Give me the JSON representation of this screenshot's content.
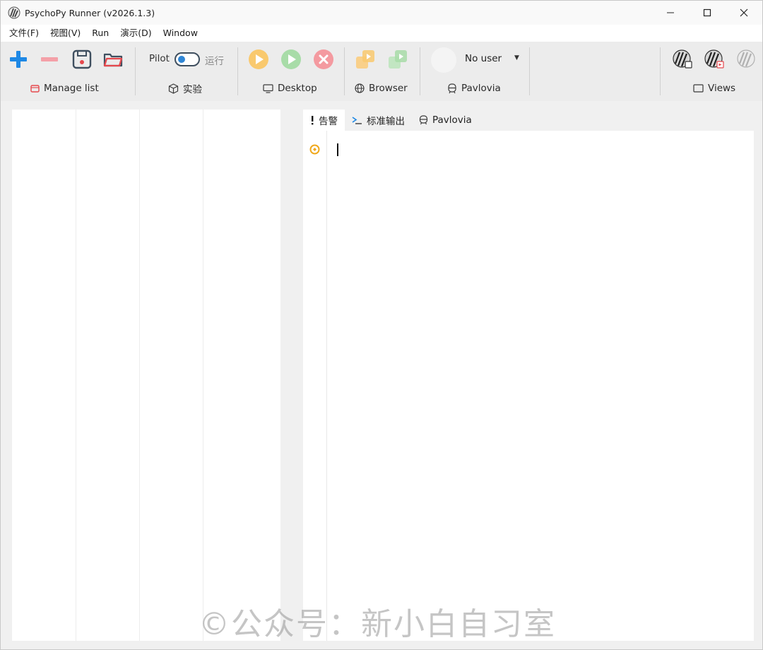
{
  "window": {
    "title": "PsychoPy Runner (v2026.1.3)"
  },
  "menu": {
    "items": [
      {
        "label": "文件(F)"
      },
      {
        "label": "视图(V)"
      },
      {
        "label": "Run"
      },
      {
        "label": "演示(D)"
      },
      {
        "label": "Window"
      }
    ]
  },
  "toolbar": {
    "manage_list": {
      "label": "Manage list",
      "icons": [
        "add-icon",
        "remove-icon",
        "save-icon",
        "open-folder-icon"
      ]
    },
    "experiment": {
      "pilot_label": "Pilot",
      "run_label": "运行",
      "label": "实验"
    },
    "desktop": {
      "label": "Desktop",
      "icons": [
        "pilot-play-icon",
        "run-play-icon",
        "stop-icon"
      ]
    },
    "browser": {
      "label": "Browser",
      "icons": [
        "browser-pilot-icon",
        "browser-run-icon"
      ]
    },
    "pavlovia": {
      "user": "No user",
      "label": "Pavlovia"
    },
    "views": {
      "label": "Views",
      "icons": [
        "builder-view-icon",
        "coder-view-icon",
        "runner-view-icon"
      ]
    }
  },
  "output": {
    "tabs": [
      {
        "label": "告警",
        "icon": "alert-icon",
        "active": true
      },
      {
        "label": "标准输出",
        "icon": "terminal-icon",
        "active": false
      },
      {
        "label": "Pavlovia",
        "icon": "pavlovia-icon",
        "active": false
      }
    ]
  },
  "watermark": "©公众号：新小白自习室",
  "colors": {
    "accent_blue": "#1e88e5",
    "remove_pink": "#f4a0a8",
    "pilot_orange": "#f9c96e",
    "run_green": "#a8dca8",
    "stop_red": "#f49aa0",
    "marker_orange": "#f0a81c"
  }
}
